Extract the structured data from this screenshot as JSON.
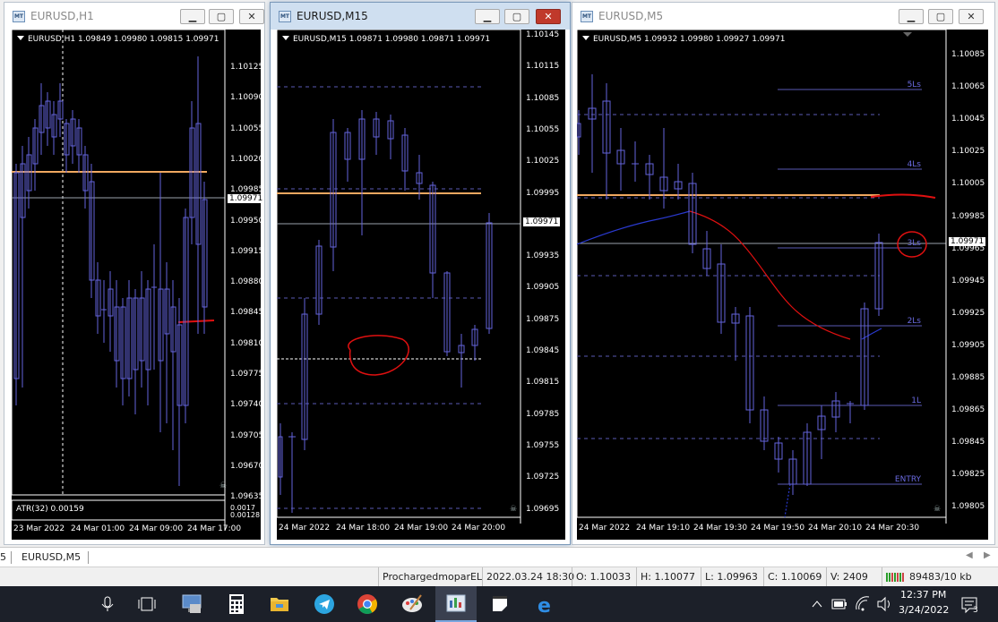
{
  "windows": [
    {
      "title": "EURUSD,H1",
      "header": "EURUSD,H1  1.09849 1.09980 1.09815 1.09971",
      "price_labels": [
        "1.10125",
        "1.10090",
        "1.10055",
        "1.10020",
        "1.09985",
        "1.09950",
        "1.09915",
        "1.09880",
        "1.09845",
        "1.09810",
        "1.09775",
        "1.09740",
        "1.09705",
        "1.09670",
        "1.09635"
      ],
      "current_price": "1.09971",
      "time_labels": [
        "23 Mar 2022",
        "24 Mar 01:00",
        "24 Mar 09:00",
        "24 Mar 17:00"
      ],
      "indicator_label": "ATR(32) 0.00159",
      "indicator_values": [
        "0.0017",
        "0.00128"
      ]
    },
    {
      "title": "EURUSD,M15",
      "header": "EURUSD,M15  1.09871 1.09980 1.09871 1.09971",
      "price_labels": [
        "1.10145",
        "1.10115",
        "1.10085",
        "1.10055",
        "1.10025",
        "1.09995",
        "1.09965",
        "1.09935",
        "1.09905",
        "1.09875",
        "1.09845",
        "1.09815",
        "1.09785",
        "1.09755",
        "1.09725",
        "1.09695"
      ],
      "current_price": "1.09971",
      "time_labels": [
        "24 Mar 2022",
        "24 Mar 18:00",
        "24 Mar 19:00",
        "24 Mar 20:00"
      ]
    },
    {
      "title": "EURUSD,M5",
      "header": "EURUSD,M5  1.09932 1.09980 1.09927 1.09971",
      "price_labels": [
        "1.10085",
        "1.10065",
        "1.10045",
        "1.10025",
        "1.10005",
        "1.09985",
        "1.09965",
        "1.09945",
        "1.09925",
        "1.09905",
        "1.09885",
        "1.09865",
        "1.09845",
        "1.09825",
        "1.09805"
      ],
      "current_price": "1.09971",
      "time_labels": [
        "24 Mar 2022",
        "24 Mar 19:10",
        "24 Mar 19:30",
        "24 Mar 19:50",
        "24 Mar 20:10",
        "24 Mar 20:30"
      ],
      "level_labels": [
        "5Ls",
        "4Ls",
        "3Ls",
        "2Ls",
        "1L",
        "ENTRY"
      ]
    }
  ],
  "tabs": [
    "5",
    "EURUSD,M5"
  ],
  "status": {
    "profile": "ProchargedmoparEL",
    "datetime": "2022.03.24 18:30",
    "open": "O: 1.10033",
    "high": "H: 1.10077",
    "low": "L: 1.09963",
    "close": "C: 1.10069",
    "volume": "V: 2409",
    "traffic": "89483/10 kb"
  },
  "taskbar": {
    "time": "12:37 PM",
    "date": "3/24/2022",
    "notification_count": "3"
  },
  "colors": {
    "candle": "#6464dc",
    "orange_line": "#f0a860",
    "red_markup": "#e01010"
  }
}
